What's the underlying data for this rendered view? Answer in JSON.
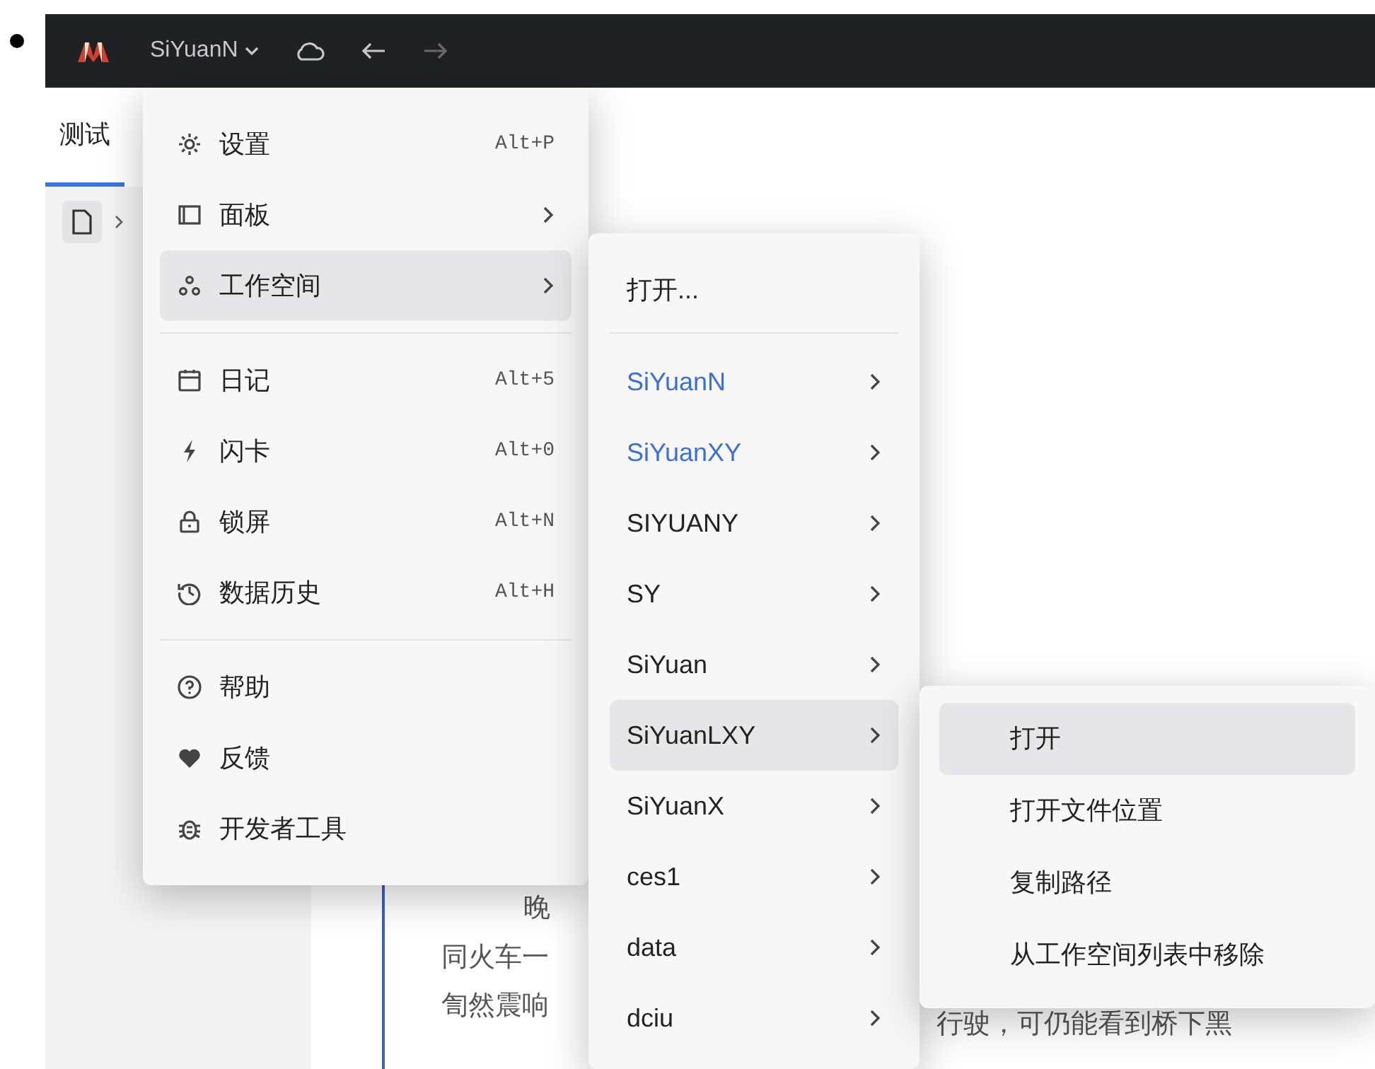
{
  "titlebar": {
    "workspace": "SiYuanN",
    "nav": [
      {
        "kind": "back",
        "disabled": false
      },
      {
        "kind": "forward",
        "disabled": true
      }
    ]
  },
  "tabs": [
    {
      "label": "测试",
      "selected": true
    }
  ],
  "document": {
    "lines": [
      "晚",
      "同火车一",
      "訇然震响"
    ],
    "line_tail": "行驶，可仍能看到桥下黑"
  },
  "main_menu": [
    {
      "kind": "item",
      "label": "设置",
      "shortcut": "Alt+P",
      "submenu": false,
      "selected": false
    },
    {
      "kind": "item",
      "label": "面板",
      "submenu": true,
      "selected": false
    },
    {
      "kind": "item",
      "label": "工作空间",
      "submenu": true,
      "selected": true
    },
    {
      "kind": "separator"
    },
    {
      "kind": "item",
      "label": "日记",
      "shortcut": "Alt+5",
      "submenu": false,
      "selected": false
    },
    {
      "kind": "item",
      "label": "闪卡",
      "shortcut": "Alt+0",
      "submenu": false,
      "selected": false
    },
    {
      "kind": "item",
      "label": "锁屏",
      "shortcut": "Alt+N",
      "submenu": false,
      "selected": false
    },
    {
      "kind": "item",
      "label": "数据历史",
      "shortcut": "Alt+H",
      "submenu": false,
      "selected": false
    },
    {
      "kind": "separator"
    },
    {
      "kind": "item",
      "label": "帮助",
      "submenu": false,
      "selected": false
    },
    {
      "kind": "item",
      "label": "反馈",
      "submenu": false,
      "selected": false
    },
    {
      "kind": "item",
      "label": "开发者工具",
      "submenu": false,
      "selected": false
    }
  ],
  "workspace_menu": {
    "open_label": "打开...",
    "workspaces": [
      {
        "label": "SiYuanN",
        "open": true,
        "selected": false
      },
      {
        "label": "SiYuanXY",
        "open": true,
        "selected": false
      },
      {
        "label": "SIYUANY",
        "open": false,
        "selected": false
      },
      {
        "label": "SY",
        "open": false,
        "selected": false
      },
      {
        "label": "SiYuan",
        "open": false,
        "selected": false
      },
      {
        "label": "SiYuanLXY",
        "open": false,
        "selected": true
      },
      {
        "label": "SiYuanX",
        "open": false,
        "selected": false
      },
      {
        "label": "ces1",
        "open": false,
        "selected": false
      },
      {
        "label": "data",
        "open": false,
        "selected": false
      },
      {
        "label": "dciu",
        "open": false,
        "selected": false
      }
    ]
  },
  "workspace_actions": [
    {
      "label": "打开",
      "selected": true
    },
    {
      "label": "打开文件位置",
      "selected": false
    },
    {
      "label": "复制路径",
      "selected": false
    },
    {
      "label": "从工作空间列表中移除",
      "selected": false
    }
  ]
}
